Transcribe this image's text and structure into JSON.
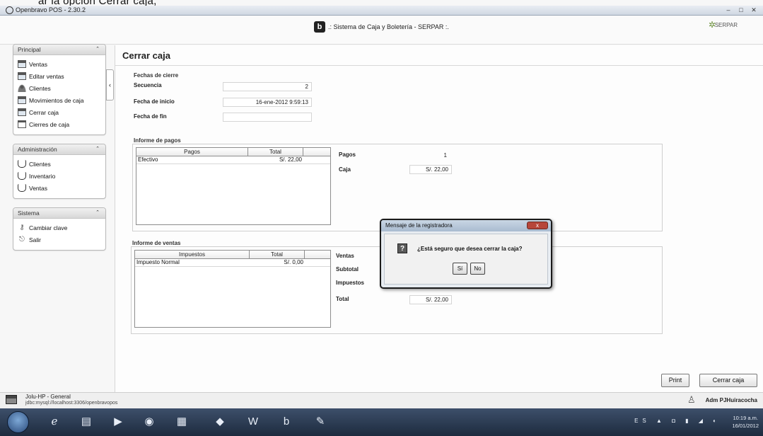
{
  "doc_heading": "ar la opción Cerrar caja,",
  "window": {
    "title": "Openbravo POS - 2.30.2",
    "controls": [
      "–",
      "□",
      "✕"
    ]
  },
  "header": {
    "logo": "b",
    "title": ".: Sistema de Caja y Boletería - SERPAR :.",
    "brand": "SERPAR"
  },
  "sidebar": {
    "principal": {
      "title": "Principal",
      "items": [
        "Ventas",
        "Editar ventas",
        "Clientes",
        "Movimientos de caja",
        "Cerrar caja",
        "Cierres de caja"
      ]
    },
    "administracion": {
      "title": "Administración",
      "items": [
        "Clientes",
        "Inventario",
        "Ventas"
      ]
    },
    "sistema": {
      "title": "Sistema",
      "items": [
        "Cambiar clave",
        "Salir"
      ]
    }
  },
  "main": {
    "title": "Cerrar caja",
    "fechas": {
      "legend": "Fechas de cierre",
      "secuencia_label": "Secuencia",
      "secuencia_value": "2",
      "inicio_label": "Fecha de inicio",
      "inicio_value": "16-ene-2012 9:59:13",
      "fin_label": "Fecha de fin",
      "fin_value": ""
    },
    "pagos": {
      "legend": "Informe de pagos",
      "columns": [
        "Pagos",
        "Total"
      ],
      "rows": [
        [
          "Efectivo",
          "S/. 22,00"
        ]
      ],
      "count_label": "Pagos",
      "count_value": "1",
      "caja_label": "Caja",
      "caja_value": "S/. 22,00"
    },
    "ventas": {
      "legend": "Informe de ventas",
      "columns": [
        "Impuestos",
        "Total"
      ],
      "rows": [
        [
          "Impuesto Normal",
          "S/. 0,00"
        ]
      ],
      "ventas_label": "Ventas",
      "subtotal_label": "Subtotal",
      "impuestos_label": "Impuestos",
      "total_label": "Total",
      "total_value": "S/. 22,00"
    },
    "print_button": "Print",
    "close_button": "Cerrar caja"
  },
  "dialog": {
    "title": "Mensaje de la registradora",
    "message": "¿Está seguro que desea cerrar la caja?",
    "yes": "Sí",
    "no": "No",
    "close": "x"
  },
  "statusbar": {
    "user": "Jolu-HP - General",
    "connection": "jdbc:mysql://localhost:3306/openbravopos",
    "admin": "Adm PJHuiracocha"
  },
  "taskbar": {
    "tray": "ES ▲ ◘ ▮ ◢ ◐",
    "time": "10:19 a.m.",
    "date": "16/01/2012"
  }
}
